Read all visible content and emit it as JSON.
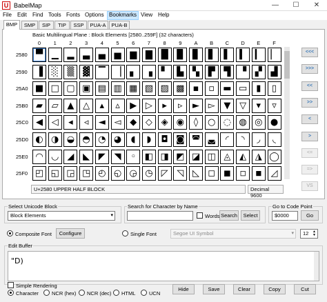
{
  "window": {
    "title": "BabelMap",
    "icon_letter": "U",
    "minimize": "—",
    "maximize": "☐",
    "close": "✕"
  },
  "menu": [
    "File",
    "Edit",
    "Find",
    "Tools",
    "Fonts",
    "Options",
    "Bookmarks",
    "View",
    "Help"
  ],
  "active_menu": "Bookmarks",
  "plane_tabs": [
    "BMP",
    "SMP",
    "SIP",
    "TIP",
    "SSP",
    "PUA-A",
    "PUA-B"
  ],
  "selected_tab": "BMP",
  "grid": {
    "caption": "Basic Multilingual Plane : Block Elements [2580..259F] (32 characters)",
    "column_headers": [
      "0",
      "1",
      "2",
      "3",
      "4",
      "5",
      "6",
      "7",
      "8",
      "9",
      "A",
      "B",
      "C",
      "D",
      "E",
      "F"
    ],
    "row_headers": [
      "2580",
      "2590",
      "25A0",
      "25B0",
      "25C0",
      "25D0",
      "25E0",
      "25F0"
    ],
    "rows": [
      [
        "▀",
        "▁",
        "▂",
        "▃",
        "▄",
        "▅",
        "▆",
        "▇",
        "█",
        "▉",
        "▊",
        "▋",
        "▌",
        "▍",
        "▎",
        "▏"
      ],
      [
        "▐",
        "░",
        "▒",
        "▓",
        "▔",
        "▕",
        "▖",
        "▗",
        "▘",
        "▙",
        "▚",
        "▛",
        "▜",
        "▝",
        "▞",
        "▟"
      ],
      [
        "■",
        "□",
        "▢",
        "▣",
        "▤",
        "▥",
        "▦",
        "▧",
        "▨",
        "▩",
        "▪",
        "▫",
        "▬",
        "▭",
        "▮",
        "▯"
      ],
      [
        "▰",
        "▱",
        "▲",
        "△",
        "▴",
        "▵",
        "▶",
        "▷",
        "▸",
        "▹",
        "►",
        "▻",
        "▼",
        "▽",
        "▾",
        "▿"
      ],
      [
        "◀",
        "◁",
        "◂",
        "◃",
        "◄",
        "◅",
        "◆",
        "◇",
        "◈",
        "◉",
        "◊",
        "○",
        "◌",
        "◍",
        "◎",
        "●"
      ],
      [
        "◐",
        "◑",
        "◒",
        "◓",
        "◔",
        "◕",
        "◖",
        "◗",
        "◘",
        "◙",
        "◚",
        "◛",
        "◜",
        "◝",
        "◞",
        "◟"
      ],
      [
        "◠",
        "◡",
        "◢",
        "◣",
        "◤",
        "◥",
        "◦",
        "◧",
        "◨",
        "◩",
        "◪",
        "◫",
        "◬",
        "◭",
        "◮",
        "◯"
      ],
      [
        "◰",
        "◱",
        "◲",
        "◳",
        "◴",
        "◵",
        "◶",
        "◷",
        "◸",
        "◹",
        "◺",
        "◻",
        "◼",
        "◽",
        "◾",
        "◿"
      ]
    ],
    "selected": "U+2580",
    "status_name": "U+2580 UPPER HALF BLOCK",
    "status_decimal": "Decimal 9600"
  },
  "nav_buttons": [
    {
      "label": "<<<",
      "enabled": true
    },
    {
      "label": ">>>",
      "enabled": true
    },
    {
      "label": "<<",
      "enabled": true
    },
    {
      "label": ">>",
      "enabled": true
    },
    {
      "label": "<",
      "enabled": true
    },
    {
      "label": ">",
      "enabled": true
    },
    {
      "label": "<=",
      "enabled": false
    },
    {
      "label": "=>",
      "enabled": false
    },
    {
      "label": "VS",
      "enabled": false
    }
  ],
  "block_select": {
    "label": "Select Unicode Block",
    "value": "Block Elements"
  },
  "search": {
    "label": "Search for Character by Name",
    "value": "",
    "words_label": "Words",
    "words_checked": false,
    "search_button": "Search",
    "select_button": "Select"
  },
  "goto": {
    "label": "Go to Code Point",
    "value": "$0000",
    "go_button": "Go"
  },
  "font": {
    "composite_label": "Composite Font",
    "configure_button": "Configure",
    "single_label": "Single Font",
    "mode": "composite",
    "font_name": "Segoe UI Symbol",
    "size": "12"
  },
  "edit_buffer": {
    "label": "Edit Buffer",
    "content": "\"D)"
  },
  "simple_rendering": {
    "label": "Simple Rendering",
    "checked": false
  },
  "output_modes": [
    "Character",
    "NCR (hex)",
    "NCR (dec)",
    "HTML",
    "UCN"
  ],
  "output_mode": "Character",
  "actions": [
    "Hide",
    "Save",
    "Clear",
    "Copy",
    "Cut"
  ],
  "colors": {
    "accent": "#4a8ee0",
    "menu_highlight": "#cce8ff",
    "close_red": "#c00000"
  }
}
